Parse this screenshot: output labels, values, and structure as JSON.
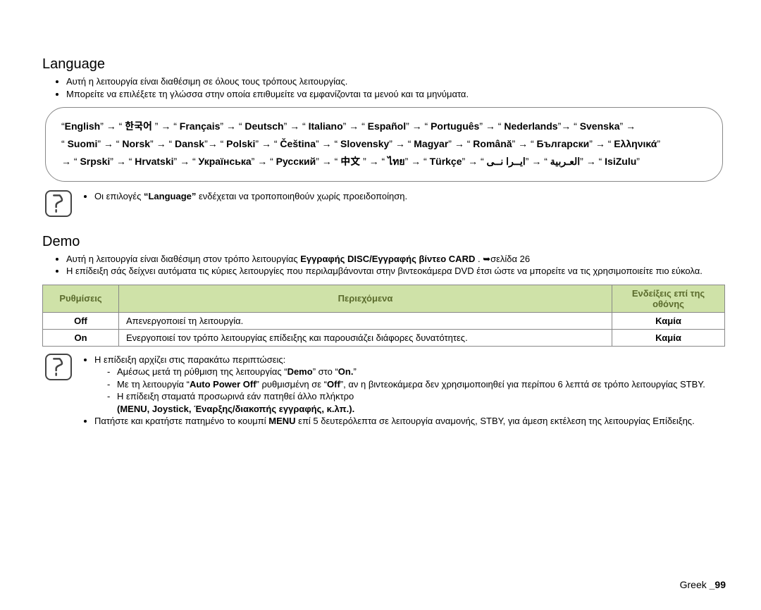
{
  "language": {
    "heading": "Language",
    "bullet1": "Αυτή η λειτουργία είναι διαθέσιμη σε όλους τους τρόπους λειτουργίας.",
    "bullet2": "Μπορείτε να επιλέξετε τη γλώσσα στην οποία επιθυμείτε να εμφανίζονται τα μενού και τα μηνύματα.",
    "langs": {
      "english": "English",
      "korean": "한국어",
      "francais": "Français",
      "deutsch": "Deutsch",
      "italiano": "Italiano",
      "espanol": "Español",
      "portugues": "Português",
      "nederlands": "Nederlands",
      "svenska": "Svenska",
      "suomi": "Suomi",
      "norsk": "Norsk",
      "dansk": "Dansk",
      "polski": "Polski",
      "cestina": "Čeština",
      "slovensky": "Slovensky",
      "magyar": "Magyar",
      "romana": "Română",
      "bulgarian": "Български",
      "greek": "Ελληνικά",
      "srpski": "Srpski",
      "hrvatski": "Hrvatski",
      "ukrainian": "Українська",
      "russian": "Русский",
      "chinese": "中文",
      "thai": "ไทย",
      "turkce": "Türkçe",
      "farsi": "ايــرا نــی",
      "arabic": "العـربية",
      "isizulu": "IsiZulu"
    },
    "note_pre": "Οι επιλογές ",
    "note_strong": "“Language”",
    "note_post": " ενδέχεται να τροποποιηθούν χωρίς προειδοποίηση."
  },
  "demo": {
    "heading": "Demo",
    "b1_pre": "Αυτή η λειτουργία είναι διαθέσιμη στον τρόπο λειτουργίας ",
    "b1_strong": "Εγγραφής DISC/Εγγραφής βίντεο CARD",
    "b1_post": ". ➥σελίδα 26",
    "b2": "Η επίδειξη σάς δείχνει αυτόματα τις κύριες λειτουργίες που περιλαμβάνονται στην βιντεοκάμερα DVD έτσι ώστε να μπορείτε να τις χρησιμοποιείτε πιο εύκολα.",
    "table": {
      "h1": "Ρυθμίσεις",
      "h2": "Περιεχόμενα",
      "h3": "Ενδείξεις επί της οθόνης",
      "r1c1": "Off",
      "r1c2": "Απενεργοποιεί τη λειτουργία.",
      "r1c3": "Καμία",
      "r2c1": "On",
      "r2c2": "Ενεργοποιεί τον τρόπο λειτουργίας επίδειξης και παρουσιάζει διάφορες δυνατότητες.",
      "r2c3": "Καμία"
    },
    "n1": "Η επίδειξη αρχίζει στις παρακάτω περιπτώσεις:",
    "d1_pre": "Αμέσως μετά τη ρύθμιση της λειτουργίας “",
    "d1_s1": "Demo",
    "d1_mid": "” στο “",
    "d1_s2": "On.",
    "d1_post": "”",
    "d2_pre": "Με τη λειτουργία “",
    "d2_s1": "Auto Power Off",
    "d2_mid": "” ρυθμισμένη σε “",
    "d2_s2": "Off",
    "d2_post": "”, αν η βιντεοκάμερα δεν χρησιμοποιηθεί για περίπου 6 λεπτά σε τρόπο λειτουργίας STBY.",
    "d3": "Η επίδειξη σταματά προσωρινά εάν πατηθεί άλλο πλήκτρο",
    "d3_strong": "(MENU, Joystick, Έναρξης/διακοπής εγγραφής, κ.λπ.).",
    "n2_pre": "Πατήστε και κρατήστε πατημένο το κουμπί ",
    "n2_s": "MENU",
    "n2_post": " επί 5 δευτερόλεπτα σε λειτουργία αναμονής, STBY, για άμεση εκτέλεση της λειτουργίας Επίδειξης."
  },
  "page_lang": "Greek ",
  "page_num": "_99"
}
